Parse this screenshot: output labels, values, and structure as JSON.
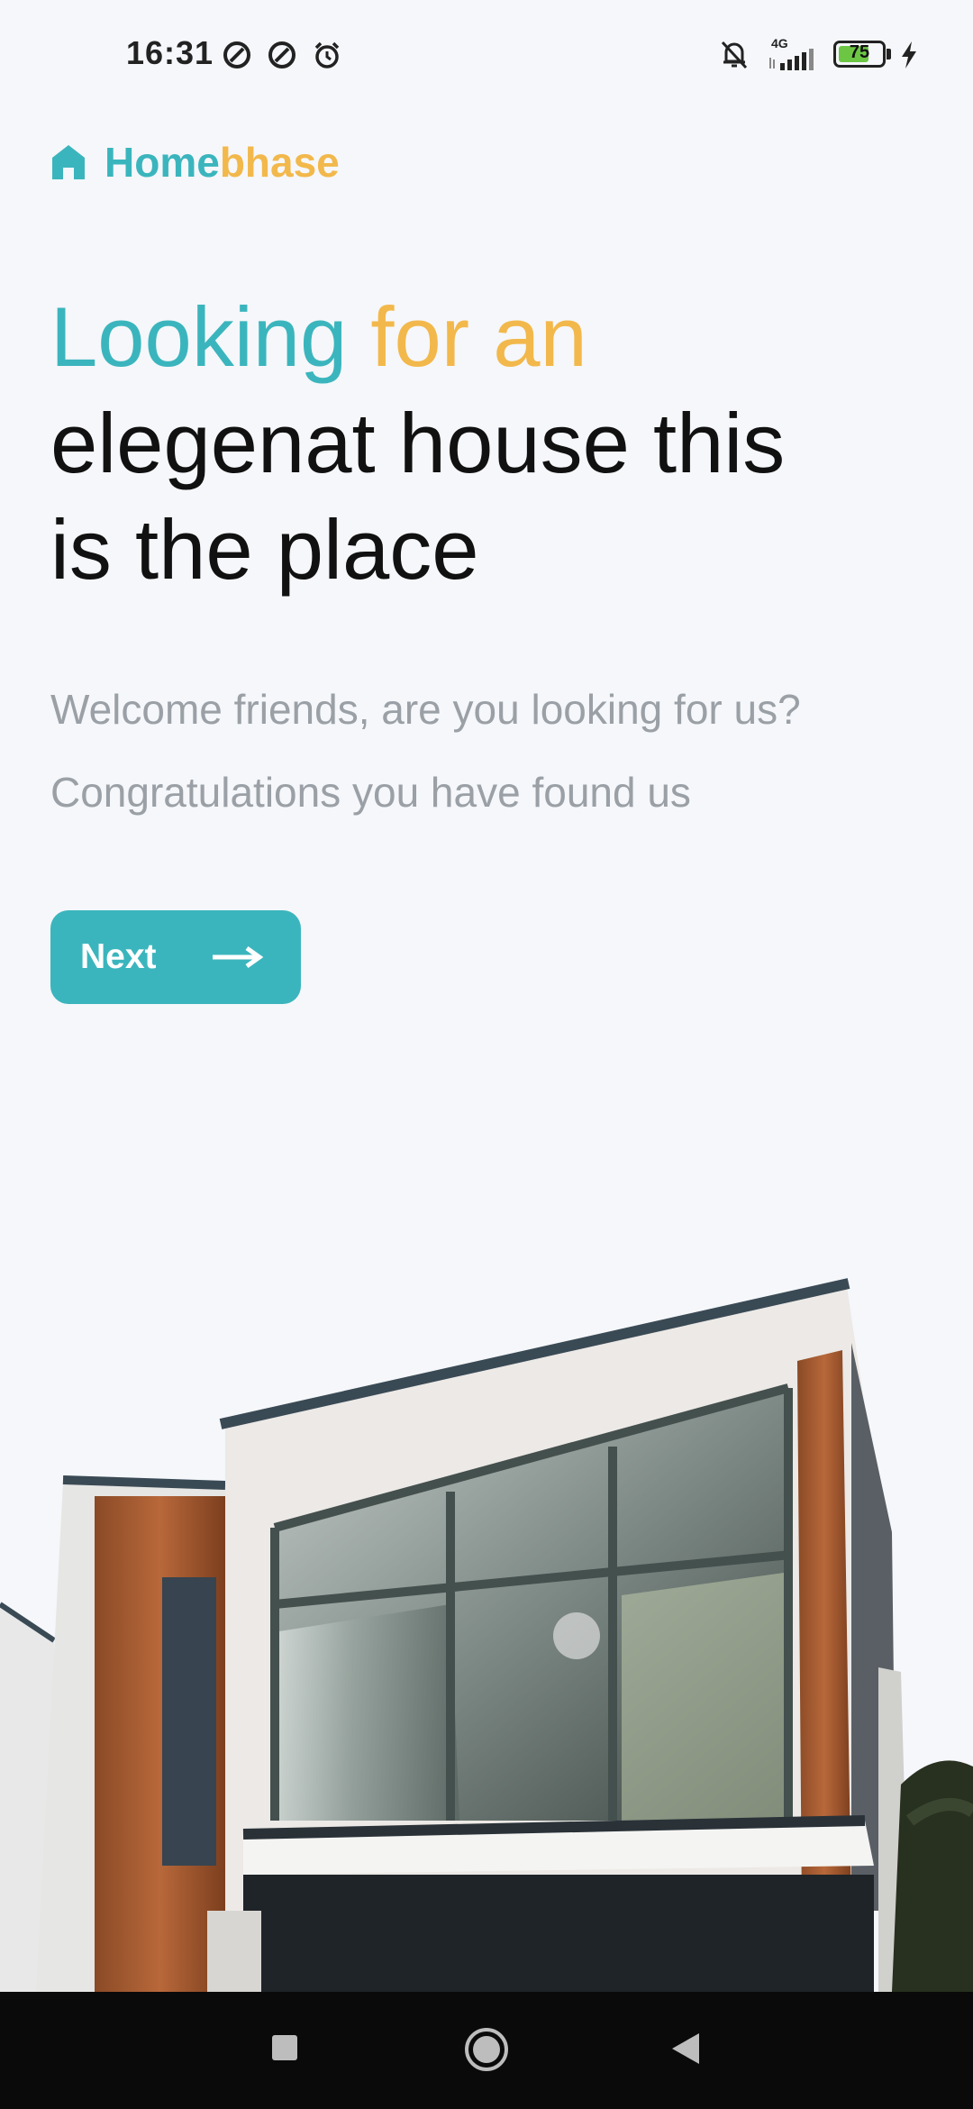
{
  "status_bar": {
    "time": "16:31",
    "network": "4G",
    "battery": "75",
    "battery_level": 0.75,
    "icons": [
      "data-saver-icon",
      "data-saver-icon",
      "alarm-icon",
      "bell-off-icon",
      "signal-icon",
      "battery-icon",
      "charging-icon"
    ]
  },
  "brand": {
    "name_part1": "Home",
    "name_part2": "bhase",
    "icon": "home-icon",
    "color_primary": "#3bb5bd",
    "color_secondary": "#f2b84b"
  },
  "hero": {
    "headline_part1": "Looking",
    "headline_part2": "for an",
    "headline_line2": "elegenat house this",
    "headline_line3": "is the place",
    "subtitle_line1": "Welcome friends, are you looking for us?",
    "subtitle_line2": "Congratulations you have found us"
  },
  "next_button": {
    "label": "Next",
    "icon": "arrow-right-icon"
  },
  "nav_bar": {
    "buttons": [
      "recents-square-icon",
      "home-circle-icon",
      "back-triangle-icon"
    ]
  }
}
